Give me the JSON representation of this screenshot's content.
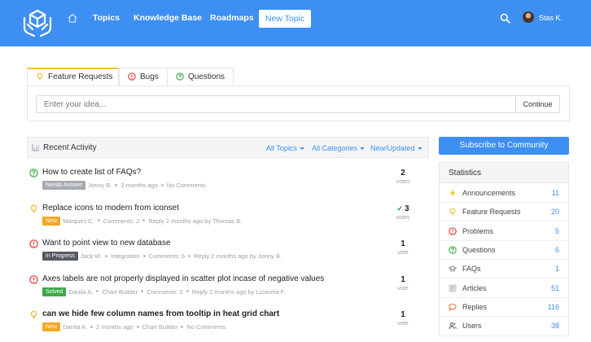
{
  "header": {
    "nav": [
      "Topics",
      "Knowledge Base",
      "Roadmaps"
    ],
    "new_topic": "New Topic",
    "user_name": "Stas K."
  },
  "idea": {
    "tabs": [
      "Feature Requests",
      "Bugs",
      "Questions"
    ],
    "input_placeholder": "Enter your idea...",
    "continue_label": "Continue"
  },
  "activity": {
    "title": "Recent Activity",
    "filters": [
      "All Topics",
      "All Categories",
      "New/Updated"
    ]
  },
  "topics": [
    {
      "icon": "question-icon",
      "title": "How to create list of FAQs?",
      "bold": false,
      "badge": "Needs Answer",
      "badge_color": "#a7abb1",
      "meta": [
        "Jonny B.",
        "2 months ago",
        "No Comments"
      ],
      "votes": "2",
      "votes_label": "votes",
      "voted": false
    },
    {
      "icon": "lightbulb-icon",
      "title": "Replace icons to modern from iconset",
      "bold": false,
      "badge": "New",
      "badge_color": "#f5a623",
      "meta": [
        "Marques C.",
        "Comments: 2",
        "Reply 2 months ago by Thomas B."
      ],
      "votes": "3",
      "votes_label": "votes",
      "voted": true
    },
    {
      "icon": "alert-icon",
      "title": "Want to point view to new database",
      "bold": false,
      "badge": "In Progress",
      "badge_color": "#555a61",
      "meta": [
        "Jack W.",
        "Integration",
        "Comments: 6",
        "Reply 2 months ago by Jonny B."
      ],
      "votes": "1",
      "votes_label": "vote",
      "voted": false
    },
    {
      "icon": "alert-icon",
      "title": "Axes labels are not properly displayed in scatter plot incase of negative values",
      "bold": false,
      "badge": "Solved",
      "badge_color": "#3ca84a",
      "meta": [
        "Danila A.",
        "Chart Builder",
        "Comments: 2",
        "Reply 2 months ago by Lizaveta F."
      ],
      "votes": "1",
      "votes_label": "vote",
      "voted": false
    },
    {
      "icon": "lightbulb-icon",
      "title": "can we hide few column names from tooltip in heat grid chart",
      "bold": true,
      "badge": "New",
      "badge_color": "#f5a623",
      "meta": [
        "Danila A.",
        "2 months ago",
        "Chart Builder",
        "No Comments"
      ],
      "votes": "1",
      "votes_label": "vote",
      "voted": false
    }
  ],
  "sidebar": {
    "subscribe_label": "Subscribe to Community",
    "stats_title": "Statistics",
    "stats": [
      {
        "icon": "bolt-icon",
        "label": "Announcements",
        "count": "11"
      },
      {
        "icon": "lightbulb-icon",
        "label": "Feature Requests",
        "count": "20"
      },
      {
        "icon": "alert-icon",
        "label": "Problems",
        "count": "5"
      },
      {
        "icon": "question-icon",
        "label": "Questions",
        "count": "6"
      },
      {
        "icon": "graduation-cap-icon",
        "label": "FAQs",
        "count": "1"
      },
      {
        "icon": "article-icon",
        "label": "Articles",
        "count": "51"
      },
      {
        "icon": "reply-icon",
        "label": "Replies",
        "count": "116"
      },
      {
        "icon": "users-icon",
        "label": "Users",
        "count": "38"
      }
    ]
  },
  "colors": {
    "brand": "#3d8ff2",
    "idea": "#f0c040",
    "problem": "#e04848",
    "question": "#4caf50"
  }
}
